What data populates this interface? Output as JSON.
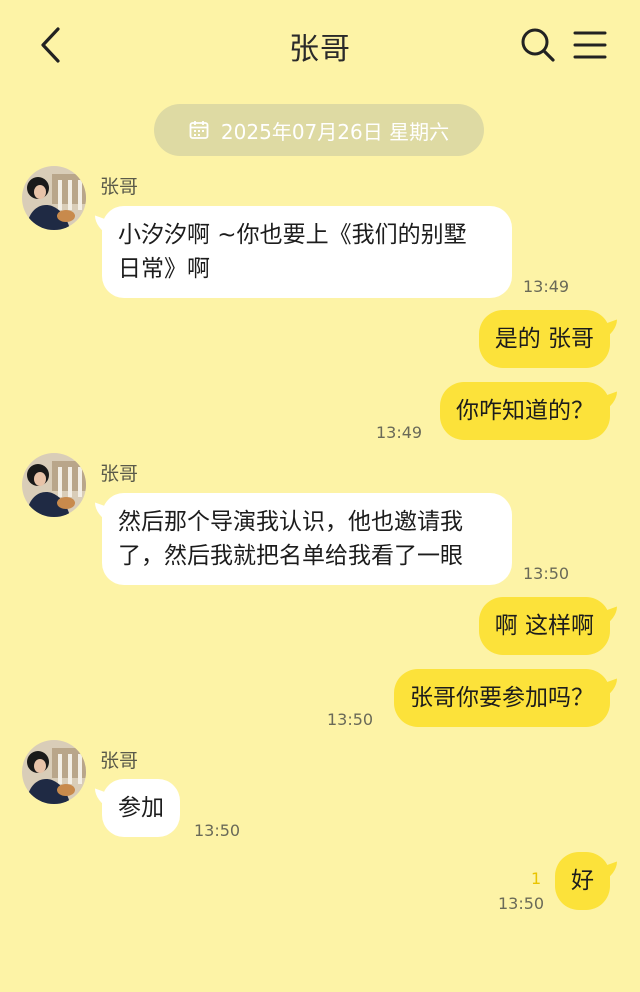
{
  "header": {
    "title": "张哥",
    "back_icon": "chevron-left-icon",
    "search_icon": "search-icon",
    "menu_icon": "menu-icon"
  },
  "date_divider": {
    "icon": "calendar-icon",
    "text": "2025年07月26日 星期六"
  },
  "messages": [
    {
      "direction": "in",
      "sender": "张哥",
      "lines": [
        "小汐汐啊 ~你也要上《我们的别墅",
        "日常》啊"
      ],
      "time": "13:49"
    },
    {
      "direction": "out",
      "lines": [
        "是的 张哥"
      ],
      "time": ""
    },
    {
      "direction": "out",
      "lines": [
        "你咋知道的？"
      ],
      "time": "13:49"
    },
    {
      "direction": "in",
      "sender": "张哥",
      "lines": [
        "然后那个导演我认识，他也邀请我",
        "了，然后我就把名单给我看了一眼"
      ],
      "time": "13:50"
    },
    {
      "direction": "out",
      "lines": [
        "啊 这样啊"
      ],
      "time": ""
    },
    {
      "direction": "out",
      "lines": [
        "张哥你要参加吗？"
      ],
      "time": "13:50"
    },
    {
      "direction": "in",
      "sender": "张哥",
      "lines": [
        "参加"
      ],
      "time": "13:50"
    },
    {
      "direction": "out",
      "lines": [
        "好"
      ],
      "time": "13:50",
      "unread_count": "1"
    }
  ],
  "colors": {
    "background": "#fdf3a6",
    "outgoing_bubble": "#fce23a",
    "incoming_bubble": "#ffffff",
    "date_pill": "#dedaa3"
  }
}
